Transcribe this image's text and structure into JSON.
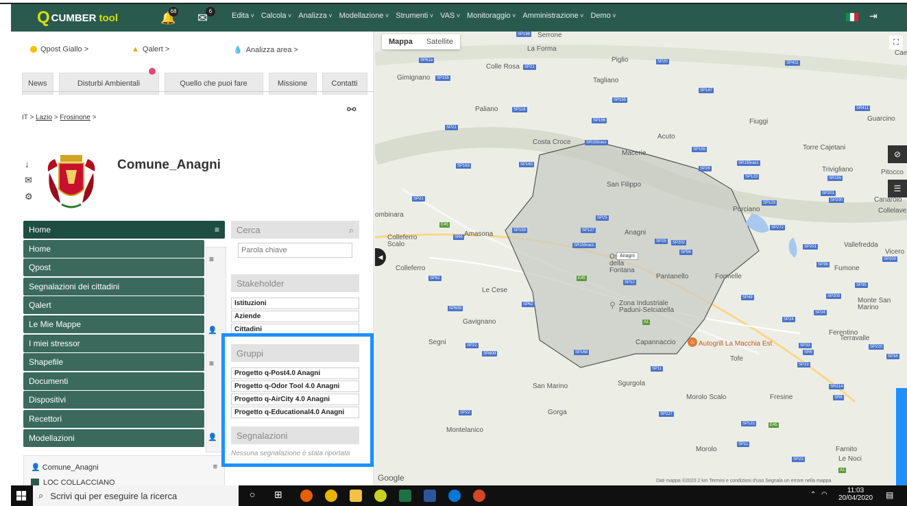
{
  "header": {
    "logo_main": "CUMBER",
    "logo_tool": "tool",
    "bell_count": "68",
    "mail_count": "6",
    "menu": [
      "Edita",
      "Calcola",
      "Analizza",
      "Modellazione",
      "Strumenti",
      "VAS",
      "Monitoraggio",
      "Amministrazione",
      "Demo"
    ]
  },
  "quick_links": {
    "qpost": "Qpost Giallo >",
    "qalert": "Qalert >",
    "analizza": "Analizza area >"
  },
  "tabs": [
    "News",
    "Disturbi Ambientali",
    "Quello che puoi fare",
    "Missione",
    "Contatti"
  ],
  "breadcrumb": {
    "it": "IT >",
    "lazio": "Lazio",
    "frosinone": "Frosinone",
    "sep": ">"
  },
  "comune": {
    "title": "Comune_Anagni",
    "card_title": "Comune_Anagni",
    "card_item": "LOC COLLACCIANO"
  },
  "nav": {
    "head": "Home",
    "items": [
      "Home",
      "Qpost",
      "Segnalazioni dei cittadini",
      "Qalert",
      "Le Mie Mappe",
      "I miei stressor",
      "Shapefile",
      "Documenti",
      "Dispositivi",
      "Recettori",
      "Modellazioni"
    ]
  },
  "search": {
    "label": "Cerca",
    "placeholder": "Parola chiave"
  },
  "stakeholder": {
    "label": "Stakeholder",
    "items": [
      "Istituzioni",
      "Aziende",
      "Cittadini"
    ]
  },
  "gruppi": {
    "label": "Gruppi",
    "items": [
      "Progetto q-Post4.0 Anagni",
      "Progetto q-Odor Tool 4.0 Anagni",
      "Progetto q-AirCity 4.0 Anagni",
      "Progetto q-Educational4.0 Anagni"
    ]
  },
  "segnalazioni": {
    "label": "Segnalazioni",
    "empty": "Nessuna segnalazione è stata riportata"
  },
  "map": {
    "tab_map": "Mappa",
    "tab_sat": "Satellite",
    "google": "Google",
    "footer": "Dati mappa ©2020  2 km    Termini e condizioni d'uso   Segnala un errore nella mappa",
    "marker": "Anagni",
    "places": [
      "Serrone",
      "La Forma",
      "Piglio",
      "Colle Rosa",
      "Gimignano",
      "Tagliano",
      "Paliano",
      "Fiuggi",
      "Guarcino",
      "Acuto",
      "Costa Croce",
      "Macerie",
      "Torre Cajetani",
      "Trivigliano",
      "Pitocco",
      "San Filippo",
      "Porciano",
      "Canarolo",
      "Collelave",
      "ombinara",
      "Amasona",
      "Anagni",
      "Colleferro Scalo",
      "Ostena della Fontana",
      "Pantanello",
      "Formelle",
      "Vallefredda",
      "Vicero",
      "Fumone",
      "Colleferro",
      "Le Cese",
      "Zona Industriale Paduni-Selciatella",
      "Monte San Marino",
      "Gavignano",
      "Ferentino",
      "Terravalle",
      "Segni",
      "Capannaccio",
      "Autogrill La Macchia Est",
      "Tofe",
      "San Marino",
      "Sgurgola",
      "Morolo Scalo",
      "Fresine",
      "Gorga",
      "Montelanico",
      "Morolo",
      "Farnito",
      "Le Noci",
      "Cae"
    ],
    "roads": [
      "SP198",
      "SP61a",
      "SP21",
      "SP155",
      "SP20",
      "SP411",
      "SP147",
      "SP155",
      "SP118",
      "SP156",
      "SP21",
      "SR155racc",
      "SR411",
      "SP155",
      "SP163",
      "SP163",
      "SP26",
      "SR155racc",
      "SP123",
      "SR155",
      "SP21",
      "SP201",
      "SP200",
      "SP123",
      "SP25",
      "SP127",
      "E45",
      "SR6",
      "SP159",
      "SP272",
      "SP25",
      "SP202",
      "SR155racc",
      "SP56",
      "SP201",
      "SP200",
      "SP36",
      "SP62",
      "E45",
      "SP12",
      "SP35",
      "SP609",
      "SP62",
      "SP49",
      "SP203",
      "SP24",
      "SP24",
      "SP22",
      "SR609",
      "SP168",
      "SP33",
      "SR6",
      "SP23",
      "SP220",
      "SP34",
      "SP11",
      "SR214",
      "SR6",
      "SP22",
      "SP227",
      "SP122",
      "E45",
      "SP11",
      "SP23",
      "A1",
      "A1"
    ]
  },
  "taskbar": {
    "search": "Scrivi qui per eseguire la ricerca",
    "time": "11:03",
    "date": "20/04/2020"
  },
  "colors": {
    "header": "#2a5a4e",
    "nav_head": "#1e4d41",
    "nav_item": "#3b6a5d",
    "highlight": "#1e90ff",
    "logo_accent": "#d5e100"
  }
}
